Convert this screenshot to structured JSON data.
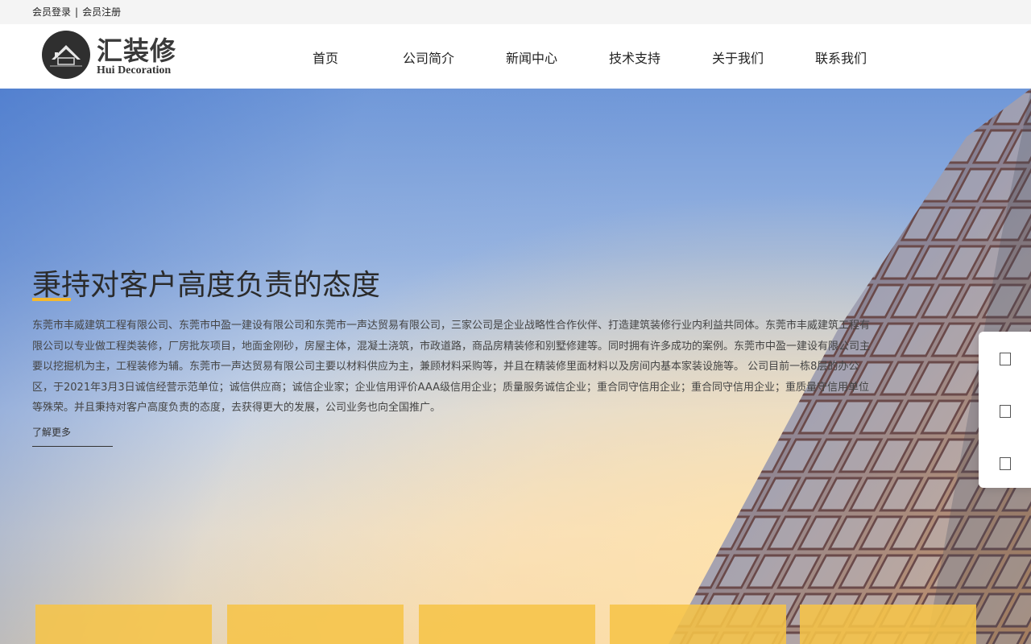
{
  "topbar": {
    "login": "会员登录",
    "separator": "|",
    "register": "会员注册"
  },
  "brand": {
    "name": "汇装修",
    "subtitle": "Hui Decoration",
    "logo_icon": "house-logo-icon"
  },
  "nav": [
    {
      "label": "首页"
    },
    {
      "label": "公司简介"
    },
    {
      "label": "新闻中心"
    },
    {
      "label": "技术支持"
    },
    {
      "label": "关于我们"
    },
    {
      "label": "联系我们"
    }
  ],
  "hero": {
    "title": "秉持对客户高度负责的态度",
    "description": "东莞市丰威建筑工程有限公司、东莞市中盈一建设有限公司和东莞市一声达贸易有限公司，三家公司是企业战略性合作伙伴、打造建筑装修行业内利益共同体。东莞市丰威建筑工程有限公司以专业做工程类装修，厂房批灰项目，地面金刚砂，房屋主体，混凝土浇筑，市政道路，商品房精装修和别墅修建等。同时拥有许多成功的案例。东莞市中盈一建设有限公司主要以挖掘机为主，工程装修为辅。东莞市一声达贸易有限公司主要以材料供应为主，兼顾材料采购等，并且在精装修里面材料以及房间内基本家装设施等。 公司目前一栋8层的办公区，于2021年3月3日诚信经营示范单位；诚信供应商；诚信企业家；企业信用评价AAA级信用企业；质量服务诚信企业；重合同守信用企业；重合同守信用企业；重质量守信用单位等殊荣。并且秉持对客户高度负责的态度，去获得更大的发展，公司业务也向全国推广。",
    "more_label": "了解更多"
  },
  "side_panel": {
    "buttons": [
      "square-icon",
      "square-icon",
      "square-icon"
    ]
  },
  "colors": {
    "accent": "#f5b82e",
    "card": "#f6c448",
    "topbar_bg": "#f4f4f4"
  }
}
